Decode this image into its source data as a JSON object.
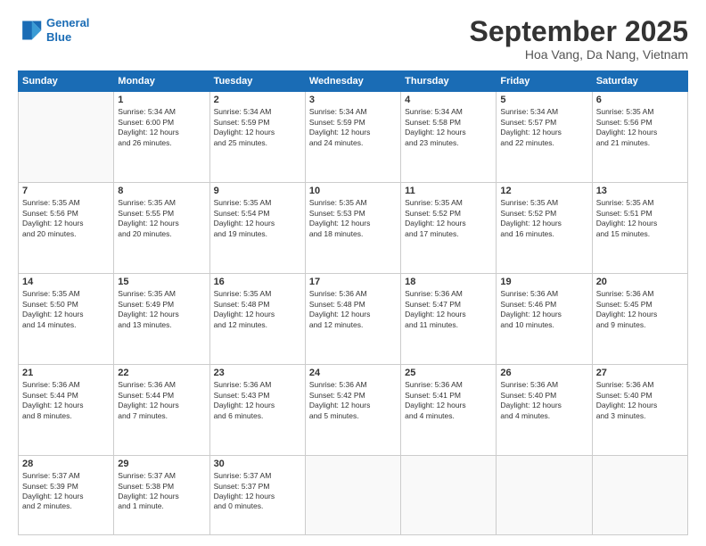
{
  "logo": {
    "line1": "General",
    "line2": "Blue"
  },
  "header": {
    "month": "September 2025",
    "location": "Hoa Vang, Da Nang, Vietnam"
  },
  "days": [
    "Sunday",
    "Monday",
    "Tuesday",
    "Wednesday",
    "Thursday",
    "Friday",
    "Saturday"
  ],
  "weeks": [
    [
      {
        "day": "",
        "info": ""
      },
      {
        "day": "1",
        "info": "Sunrise: 5:34 AM\nSunset: 6:00 PM\nDaylight: 12 hours\nand 26 minutes."
      },
      {
        "day": "2",
        "info": "Sunrise: 5:34 AM\nSunset: 5:59 PM\nDaylight: 12 hours\nand 25 minutes."
      },
      {
        "day": "3",
        "info": "Sunrise: 5:34 AM\nSunset: 5:59 PM\nDaylight: 12 hours\nand 24 minutes."
      },
      {
        "day": "4",
        "info": "Sunrise: 5:34 AM\nSunset: 5:58 PM\nDaylight: 12 hours\nand 23 minutes."
      },
      {
        "day": "5",
        "info": "Sunrise: 5:34 AM\nSunset: 5:57 PM\nDaylight: 12 hours\nand 22 minutes."
      },
      {
        "day": "6",
        "info": "Sunrise: 5:35 AM\nSunset: 5:56 PM\nDaylight: 12 hours\nand 21 minutes."
      }
    ],
    [
      {
        "day": "7",
        "info": "Sunrise: 5:35 AM\nSunset: 5:56 PM\nDaylight: 12 hours\nand 20 minutes."
      },
      {
        "day": "8",
        "info": "Sunrise: 5:35 AM\nSunset: 5:55 PM\nDaylight: 12 hours\nand 20 minutes."
      },
      {
        "day": "9",
        "info": "Sunrise: 5:35 AM\nSunset: 5:54 PM\nDaylight: 12 hours\nand 19 minutes."
      },
      {
        "day": "10",
        "info": "Sunrise: 5:35 AM\nSunset: 5:53 PM\nDaylight: 12 hours\nand 18 minutes."
      },
      {
        "day": "11",
        "info": "Sunrise: 5:35 AM\nSunset: 5:52 PM\nDaylight: 12 hours\nand 17 minutes."
      },
      {
        "day": "12",
        "info": "Sunrise: 5:35 AM\nSunset: 5:52 PM\nDaylight: 12 hours\nand 16 minutes."
      },
      {
        "day": "13",
        "info": "Sunrise: 5:35 AM\nSunset: 5:51 PM\nDaylight: 12 hours\nand 15 minutes."
      }
    ],
    [
      {
        "day": "14",
        "info": "Sunrise: 5:35 AM\nSunset: 5:50 PM\nDaylight: 12 hours\nand 14 minutes."
      },
      {
        "day": "15",
        "info": "Sunrise: 5:35 AM\nSunset: 5:49 PM\nDaylight: 12 hours\nand 13 minutes."
      },
      {
        "day": "16",
        "info": "Sunrise: 5:35 AM\nSunset: 5:48 PM\nDaylight: 12 hours\nand 12 minutes."
      },
      {
        "day": "17",
        "info": "Sunrise: 5:36 AM\nSunset: 5:48 PM\nDaylight: 12 hours\nand 12 minutes."
      },
      {
        "day": "18",
        "info": "Sunrise: 5:36 AM\nSunset: 5:47 PM\nDaylight: 12 hours\nand 11 minutes."
      },
      {
        "day": "19",
        "info": "Sunrise: 5:36 AM\nSunset: 5:46 PM\nDaylight: 12 hours\nand 10 minutes."
      },
      {
        "day": "20",
        "info": "Sunrise: 5:36 AM\nSunset: 5:45 PM\nDaylight: 12 hours\nand 9 minutes."
      }
    ],
    [
      {
        "day": "21",
        "info": "Sunrise: 5:36 AM\nSunset: 5:44 PM\nDaylight: 12 hours\nand 8 minutes."
      },
      {
        "day": "22",
        "info": "Sunrise: 5:36 AM\nSunset: 5:44 PM\nDaylight: 12 hours\nand 7 minutes."
      },
      {
        "day": "23",
        "info": "Sunrise: 5:36 AM\nSunset: 5:43 PM\nDaylight: 12 hours\nand 6 minutes."
      },
      {
        "day": "24",
        "info": "Sunrise: 5:36 AM\nSunset: 5:42 PM\nDaylight: 12 hours\nand 5 minutes."
      },
      {
        "day": "25",
        "info": "Sunrise: 5:36 AM\nSunset: 5:41 PM\nDaylight: 12 hours\nand 4 minutes."
      },
      {
        "day": "26",
        "info": "Sunrise: 5:36 AM\nSunset: 5:40 PM\nDaylight: 12 hours\nand 4 minutes."
      },
      {
        "day": "27",
        "info": "Sunrise: 5:36 AM\nSunset: 5:40 PM\nDaylight: 12 hours\nand 3 minutes."
      }
    ],
    [
      {
        "day": "28",
        "info": "Sunrise: 5:37 AM\nSunset: 5:39 PM\nDaylight: 12 hours\nand 2 minutes."
      },
      {
        "day": "29",
        "info": "Sunrise: 5:37 AM\nSunset: 5:38 PM\nDaylight: 12 hours\nand 1 minute."
      },
      {
        "day": "30",
        "info": "Sunrise: 5:37 AM\nSunset: 5:37 PM\nDaylight: 12 hours\nand 0 minutes."
      },
      {
        "day": "",
        "info": ""
      },
      {
        "day": "",
        "info": ""
      },
      {
        "day": "",
        "info": ""
      },
      {
        "day": "",
        "info": ""
      }
    ]
  ]
}
